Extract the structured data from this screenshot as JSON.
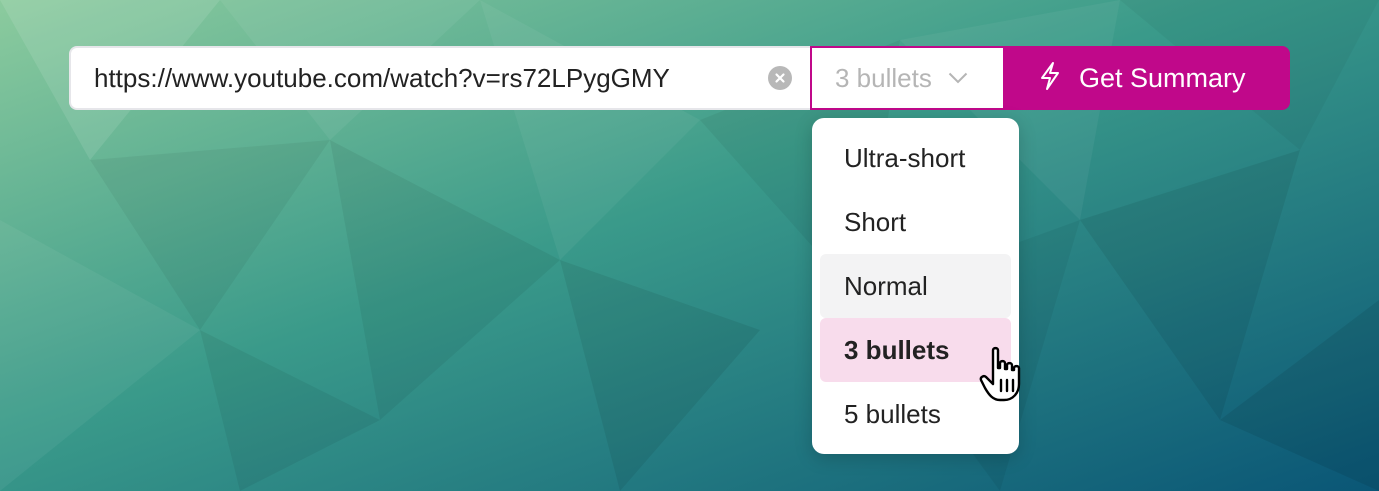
{
  "url_input": {
    "value": "https://www.youtube.com/watch?v=rs72LPygGMY",
    "clear_icon": "clear-circle-icon"
  },
  "length_select": {
    "label": "3 bullets",
    "icon": "chevron-down-icon"
  },
  "summary_button": {
    "label": "Get Summary",
    "icon": "lightning-bolt-icon"
  },
  "dropdown": {
    "options": [
      {
        "label": "Ultra-short"
      },
      {
        "label": "Short"
      },
      {
        "label": "Normal"
      },
      {
        "label": "3 bullets"
      },
      {
        "label": "5 bullets"
      }
    ],
    "hovered": "Normal",
    "selected": "3 bullets"
  },
  "colors": {
    "accent": "#c0088a",
    "selected_bg": "#f8dcec",
    "hover_bg": "#f3f3f4",
    "bg_light": "#7ec39a",
    "bg_dark": "#0a5e7a"
  }
}
